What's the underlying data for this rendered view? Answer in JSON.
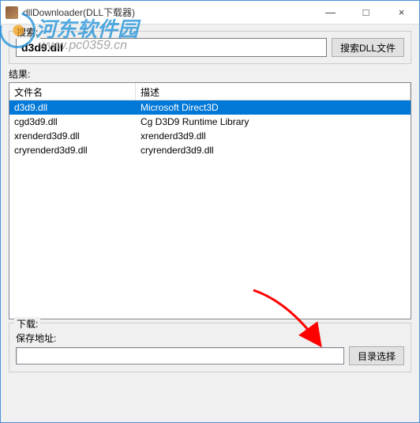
{
  "window": {
    "title": "dllDownloader(DLL下载器)",
    "minimize": "—",
    "maximize": "□",
    "close": "×"
  },
  "watermark": {
    "brand": "河东软件园",
    "url": "www.pc0359.cn"
  },
  "search": {
    "group_label": "搜索:",
    "value": "d3d9.dll",
    "button": "搜索DLL文件"
  },
  "results": {
    "label": "结果:",
    "col_name": "文件名",
    "col_desc": "描述",
    "rows": [
      {
        "name": "d3d9.dll",
        "desc": "Microsoft Direct3D",
        "selected": true
      },
      {
        "name": "cgd3d9.dll",
        "desc": "Cg D3D9 Runtime Library",
        "selected": false
      },
      {
        "name": "xrenderd3d9.dll",
        "desc": "xrenderd3d9.dll",
        "selected": false
      },
      {
        "name": "cryrenderd3d9.dll",
        "desc": "cryrenderd3d9.dll",
        "selected": false
      }
    ]
  },
  "download": {
    "group_label": "下载:",
    "save_label": "保存地址:",
    "path": "",
    "browse_button": "目录选择"
  }
}
